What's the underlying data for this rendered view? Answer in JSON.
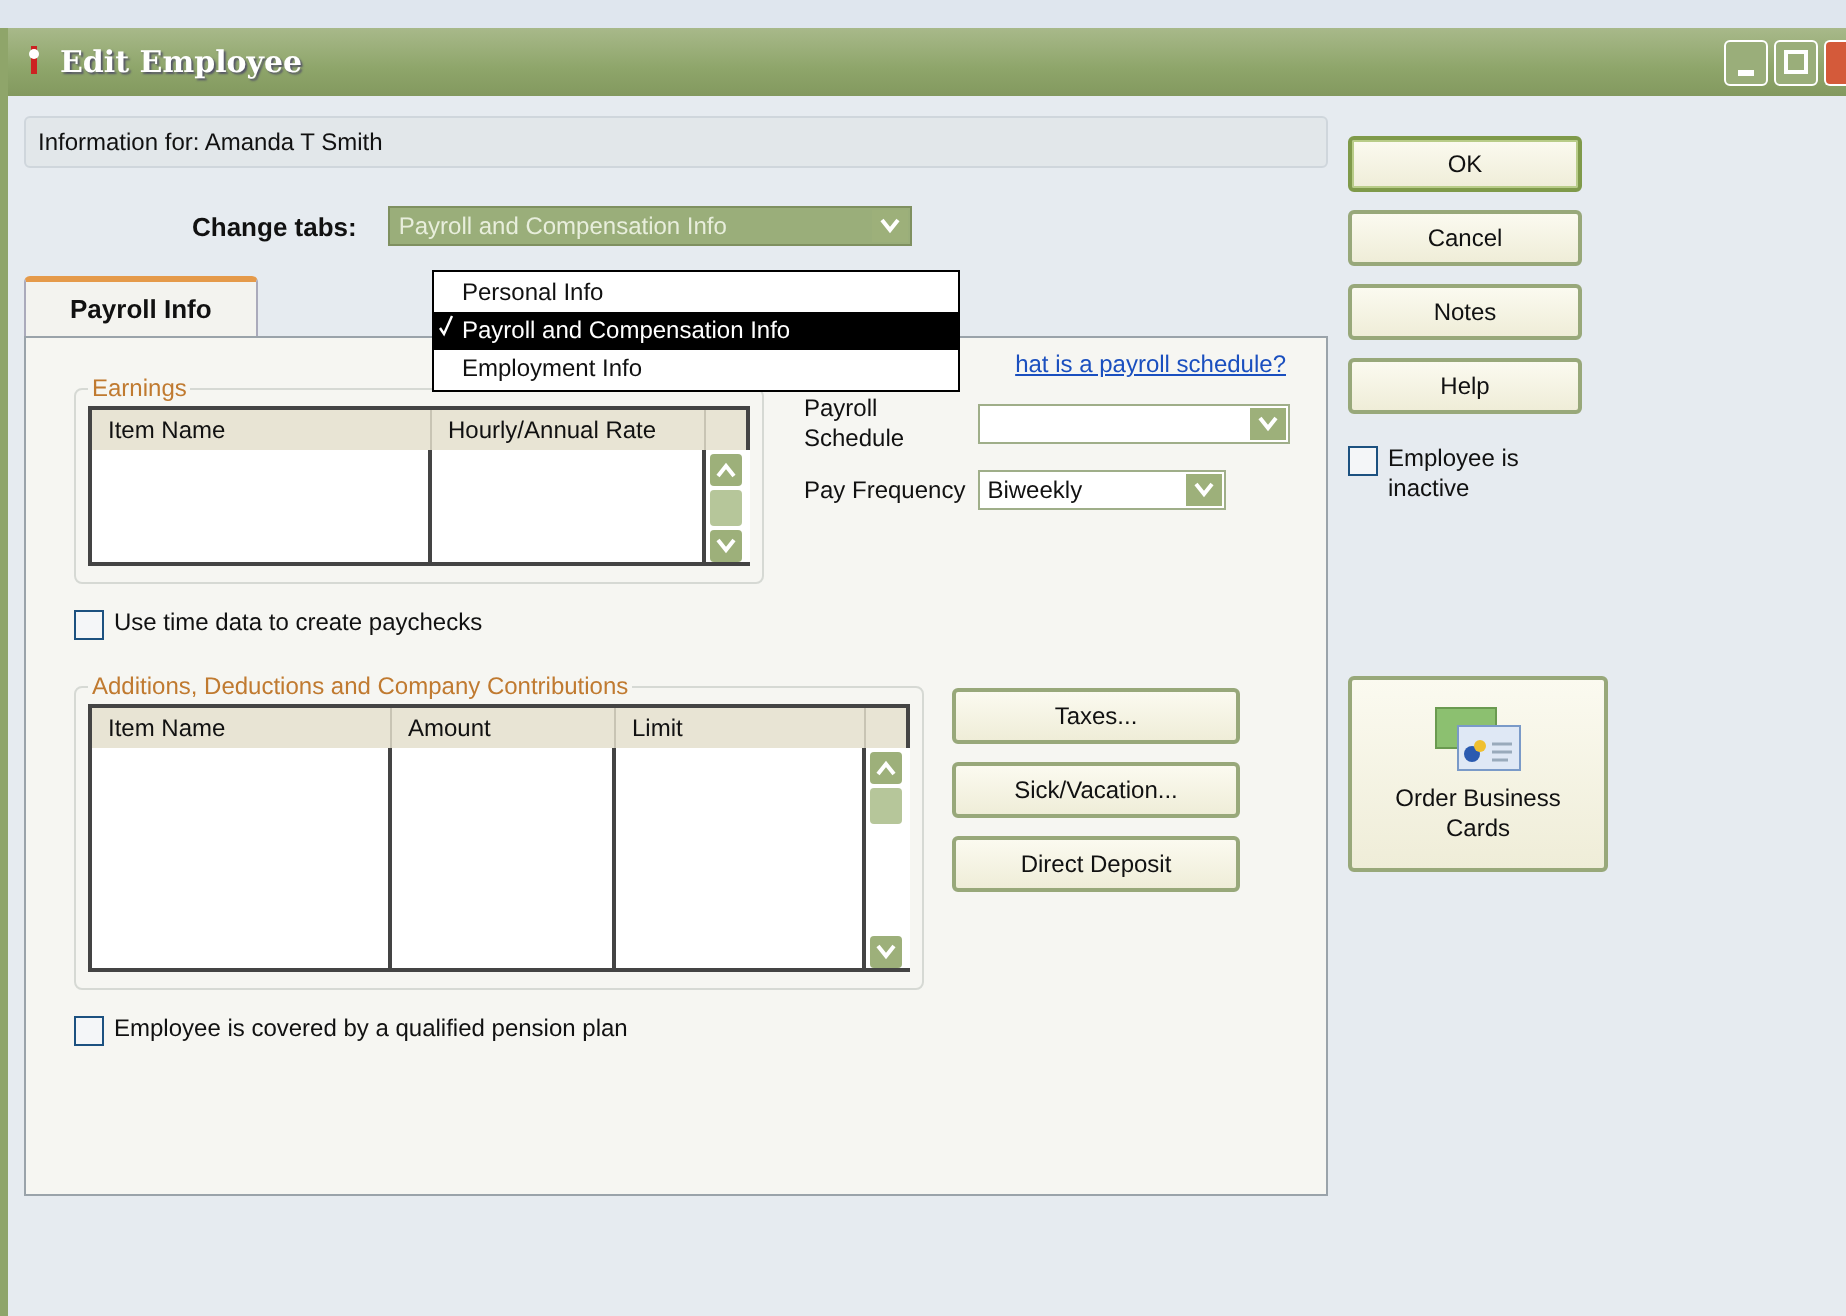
{
  "window": {
    "title": "Edit Employee"
  },
  "info": {
    "label": "Information for: Amanda T Smith"
  },
  "change_tabs": {
    "label": "Change tabs:",
    "value": "Payroll and Compensation Info",
    "expanded": true,
    "options": [
      {
        "label": "Personal Info",
        "selected": false
      },
      {
        "label": "Payroll and Compensation Info",
        "selected": true
      },
      {
        "label": "Employment Info",
        "selected": false
      }
    ]
  },
  "tabs": [
    {
      "label": "Payroll Info",
      "selected": true
    }
  ],
  "schedule_link": "hat is a payroll schedule?",
  "earnings": {
    "title": "Earnings",
    "columns": [
      "Item Name",
      "Hourly/Annual Rate"
    ]
  },
  "payroll_schedule": {
    "label": "Payroll Schedule"
  },
  "pay_frequency": {
    "label": "Pay Frequency",
    "value": "Biweekly"
  },
  "use_time_data": {
    "label": "Use time data to create paychecks",
    "checked": false
  },
  "additions": {
    "title": "Additions, Deductions and Company Contributions",
    "columns": [
      "Item Name",
      "Amount",
      "Limit"
    ]
  },
  "payroll_buttons": [
    "Taxes...",
    "Sick/Vacation...",
    "Direct Deposit"
  ],
  "pension": {
    "label": "Employee is covered by a qualified pension plan",
    "checked": false
  },
  "side_buttons": [
    "OK",
    "Cancel",
    "Notes",
    "Help"
  ],
  "inactive": {
    "label": "Employee is inactive",
    "checked": false
  },
  "business_cards": {
    "label": "Order Business Cards"
  }
}
